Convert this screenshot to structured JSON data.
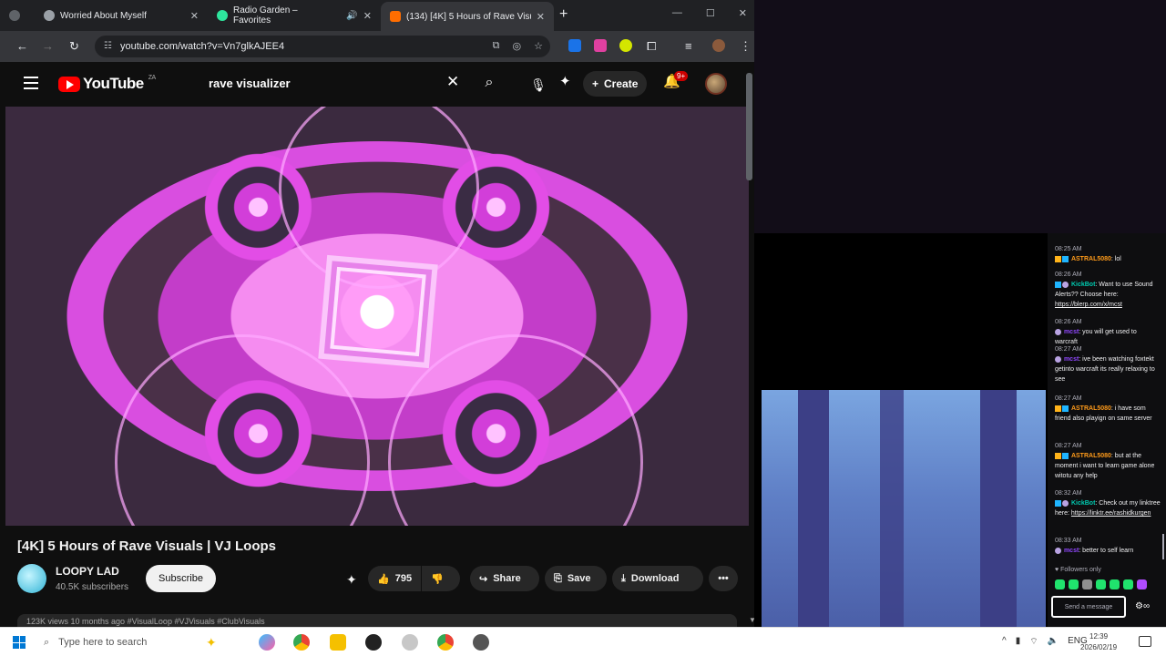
{
  "browser": {
    "tabs": [
      {
        "title": "Worried About Myself",
        "close": "✕"
      },
      {
        "title": "Radio Garden – Favorites",
        "close": "✕"
      },
      {
        "title": "(134) [4K] 5 Hours of Rave Visu",
        "close": "✕"
      }
    ],
    "new_tab": "+",
    "url": "youtube.com/watch?v=Vn7glkAJEE4"
  },
  "youtube": {
    "logo_text": "YouTube",
    "region": "ZA",
    "search_value": "rave visualizer",
    "create_label": "Create",
    "notification_badge": "9+",
    "video_title": "[4K] 5 Hours of Rave Visuals | VJ Loops",
    "channel_name": "LOOPY LAD",
    "subscribers": "40.5K subscribers",
    "subscribe_label": "Subscribe",
    "likes": "795",
    "share_label": "Share",
    "save_label": "Save",
    "download_label": "Download",
    "more_label": "•••",
    "description_preview": "123K views  10 months ago  #VisualLoop #VJVisuals #ClubVisuals"
  },
  "chat": {
    "messages": [
      {
        "time": "08:25 AM",
        "user": "ASTRAL5080",
        "text": ": lol"
      },
      {
        "time": "08:26 AM",
        "user": "KickBot",
        "text": ": Want to use Sound Alerts?? Choose here: ",
        "link": "https://blerp.com/x/mcst"
      },
      {
        "time": "08:26 AM",
        "user": "mcst",
        "text": ": you will get used to warcraft"
      },
      {
        "time": "08:27 AM",
        "user": "mcst",
        "text": ": ive been watching foxtekt getinto warcraft its really relaxing to see"
      },
      {
        "time": "08:27 AM",
        "user": "ASTRAL5080",
        "text": ": i have som friend also playign on same server"
      },
      {
        "time": "08:27 AM",
        "user": "ASTRAL5080",
        "text": ": but at the moment i want to learn game alone witotu any help"
      },
      {
        "time": "08:32 AM",
        "user": "KickBot",
        "text": ": Check out my linktree here: ",
        "link": "https://linktr.ee/rashidkurgen"
      },
      {
        "time": "08:33 AM",
        "user": "mcst",
        "text": ": better to self learn"
      }
    ],
    "followers_only": "♥ Followers only",
    "input_placeholder": "Send a message"
  },
  "taskbar": {
    "search_placeholder": "Type here to search",
    "lang": "ENG",
    "time": "12:39",
    "date": "2026/02/19"
  },
  "colors": {
    "youtube_red": "#ff0000",
    "chat_orange": "#ff9b1a",
    "chat_purple": "#9147ff",
    "video_pink": "#f58cf0"
  }
}
